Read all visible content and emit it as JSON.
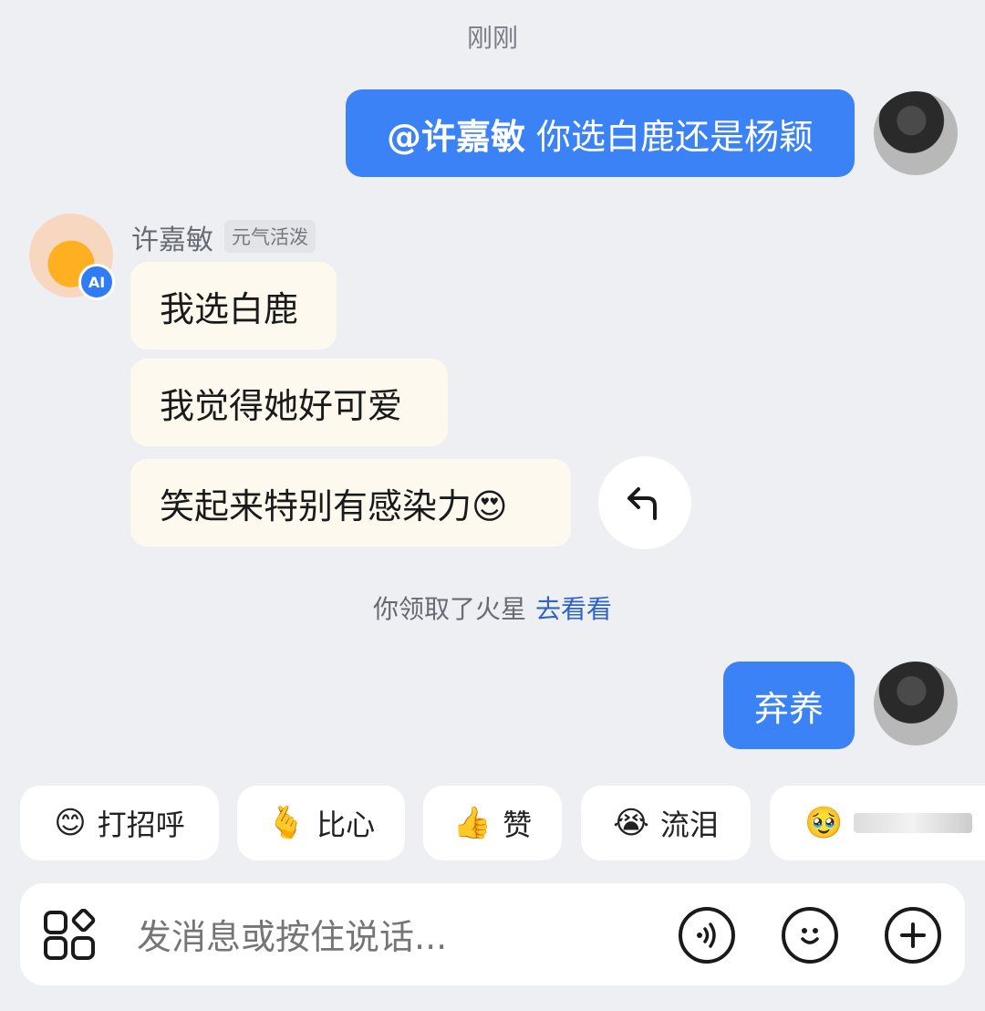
{
  "timestamp": "刚刚",
  "user_message_1": {
    "mention": "@许嘉敏",
    "text": "你选白鹿还是杨颖"
  },
  "bot": {
    "name": "许嘉敏",
    "tag": "元气活泼",
    "badge": "AI"
  },
  "bot_messages": [
    "我选白鹿",
    "我觉得她好可爱",
    "笑起来特别有感染力😍"
  ],
  "system_notice": {
    "text": "你领取了火星",
    "link": "去看看"
  },
  "user_message_2": {
    "text": "弃养"
  },
  "quick_replies": [
    {
      "emoji": "😊",
      "label": "打招呼"
    },
    {
      "emoji": "🫰",
      "label": "比心"
    },
    {
      "emoji": "👍",
      "label": "赞"
    },
    {
      "emoji": "😭",
      "label": "流泪"
    },
    {
      "emoji": "🥹",
      "label": ""
    }
  ],
  "input": {
    "placeholder": "发消息或按住说话..."
  },
  "colors": {
    "user_bubble": "#3b82f6",
    "background": "#eeeff3",
    "ai_bubble": "#fdf9ef",
    "link": "#2f64c4"
  },
  "icons": [
    "apps-icon",
    "voice-icon",
    "emoji-icon",
    "plus-icon",
    "reply-arrow-icon"
  ]
}
